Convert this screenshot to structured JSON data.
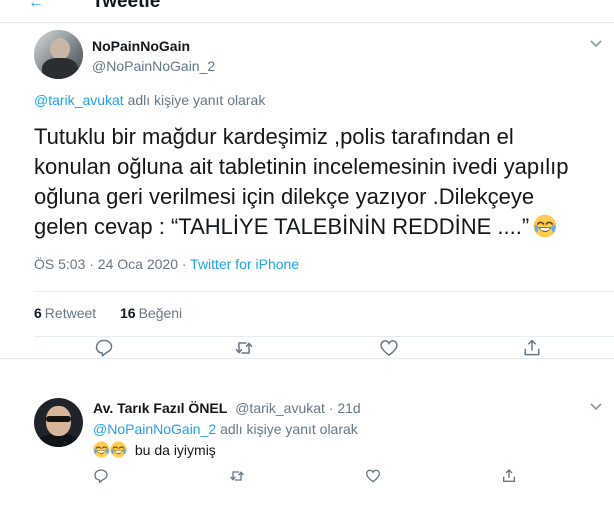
{
  "header": {
    "back_symbol": "←",
    "title": "Tweetle"
  },
  "main_tweet": {
    "author_name": "NoPainNoGain",
    "author_handle": "@NoPainNoGain_2",
    "reply_mention": "@tarik_avukat",
    "reply_suffix": "adlı kişiye yanıt olarak",
    "text": "Tutuklu bir mağdur kardeşimiz ,polis tarafından el konulan oğluna ait tabletinin incelemesinin ivedi yapılıp oğluna geri verilmesi için dilekçe yazıyor .Dilekçeye gelen cevap : “TAHLİYE TALEBİNİN REDDİNE ....”",
    "timestamp": "ÖS 5:03 · 24 Oca 2020 ·",
    "source": "Twitter for iPhone",
    "retweet_count": "6",
    "retweet_label": "Retweet",
    "like_count": "16",
    "like_label": "Beğeni",
    "icons": [
      "reply-icon",
      "retweet-icon",
      "like-icon",
      "share-icon"
    ]
  },
  "reply_tweet": {
    "author_name": "Av. Tarık Fazıl ÖNEL",
    "author_handle": "@tarik_avukat",
    "time": "· 21d",
    "reply_mention": "@NoPainNoGain_2",
    "reply_suffix": "adlı kişiye yanıt olarak",
    "text": "bu da iyiymiş"
  },
  "colors": {
    "accent": "#1da1f2",
    "text": "#14171a",
    "muted": "#657786",
    "border": "#e6ecf0"
  }
}
